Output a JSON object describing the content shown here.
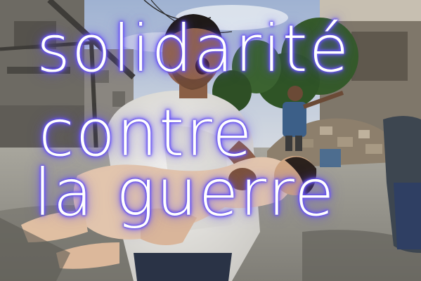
{
  "poster": {
    "headline": {
      "line_1": "solidarité",
      "line_2": "contre",
      "line_3": "la guerre"
    },
    "glow_color": "#6a55ff",
    "text_color": "#ffffff"
  }
}
